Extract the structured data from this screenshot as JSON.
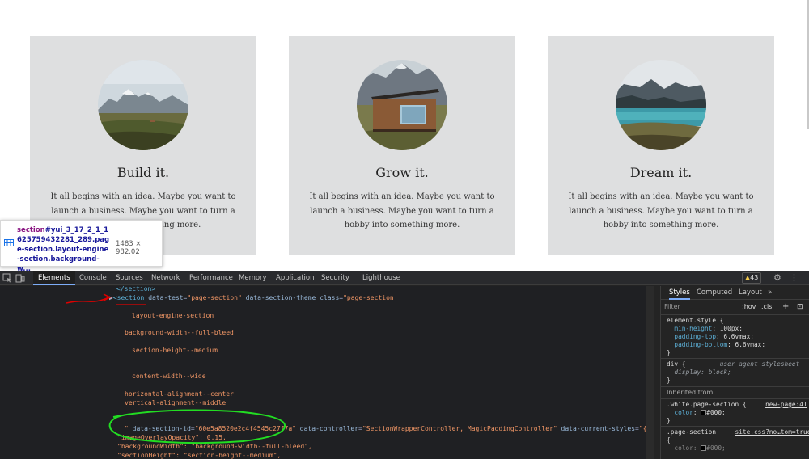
{
  "cards": [
    {
      "title": "Build it.",
      "text": "It all begins with an idea. Maybe you want to launch a business. Maybe you want to turn a hobby into something more."
    },
    {
      "title": "Grow it.",
      "text": "It all begins with an idea. Maybe you want to launch a business. Maybe you want to turn a hobby into something more."
    },
    {
      "title": "Dream it.",
      "text": "It all begins with an idea. Maybe you want to launch a business. Maybe you want to turn a hobby into something more."
    }
  ],
  "tooltip": {
    "tag": "section",
    "selector": "#yui_3_17_2_1_1625759432281_289.page-section.layout-engine-section.background-w...",
    "size": "1483 × 982.02"
  },
  "devtools": {
    "tabs": [
      "Elements",
      "Console",
      "Sources",
      "Network",
      "Performance",
      "Memory",
      "Application",
      "Security",
      "Lighthouse"
    ],
    "issues_count": "43",
    "html": {
      "close_section": "</section>",
      "section_tag": "<section",
      "attr1_name": "data-test",
      "attr1_value": "\"page-section\"",
      "attr2_name": "data-section-theme",
      "attr3_name": "class",
      "attr3_value": "\"page-section",
      "class_lines": [
        "layout-engine-section",
        "background-width--full-bleed",
        "section-height--medium",
        "content-width--wide",
        "horizontal-alignment--center",
        "vertical-alignment--middle"
      ],
      "quote_end": "\"",
      "id_name": "data-section-id",
      "id_value": "\"60e5a8520e2c4f4545c27f7a\"",
      "ctrl_name": "data-controller",
      "ctrl_value": "\"SectionWrapperController, MagicPaddingController\"",
      "styles_name": "data-current-styles",
      "styles_value": "\"{",
      "json_lines": [
        "\"imageOverlayOpacity\": 0.15,",
        "\"backgroundWidth\": \"background-width--full-bleed\",",
        "\"sectionHeight\": \"section-height--medium\","
      ]
    },
    "styles_pane": {
      "subtabs": [
        "Styles",
        "Computed",
        "Layout"
      ],
      "more": "»",
      "filter_placeholder": "Filter",
      "hov": ":hov",
      "cls": ".cls",
      "plus": "+",
      "element_style_selector": "element.style {",
      "element_style_props": [
        {
          "name": "min-height",
          "value": "100px;"
        },
        {
          "name": "padding-top",
          "value": "6.6vmax;"
        },
        {
          "name": "padding-bottom",
          "value": "6.6vmax;"
        }
      ],
      "close_brace": "}",
      "div_selector": "div {",
      "ua_label": "user agent stylesheet",
      "div_prop": {
        "name": "display",
        "value": "block;"
      },
      "inherited_label": "Inherited from ...",
      "white_selector": ".white.page-section {",
      "white_link": "new-page:41",
      "white_prop": {
        "name": "color",
        "value": "#000;"
      },
      "ps_selector": ".page-section",
      "ps_link": "site.css?no…tom=true:15",
      "ps_open": "{",
      "ps_prop": {
        "name": "color",
        "value": "#000;"
      }
    }
  },
  "colors": {
    "card_bg": "#dedfe0",
    "devtools_bg": "#1f2023",
    "annotation_red": "#e00000",
    "annotation_green": "#22dd22"
  }
}
